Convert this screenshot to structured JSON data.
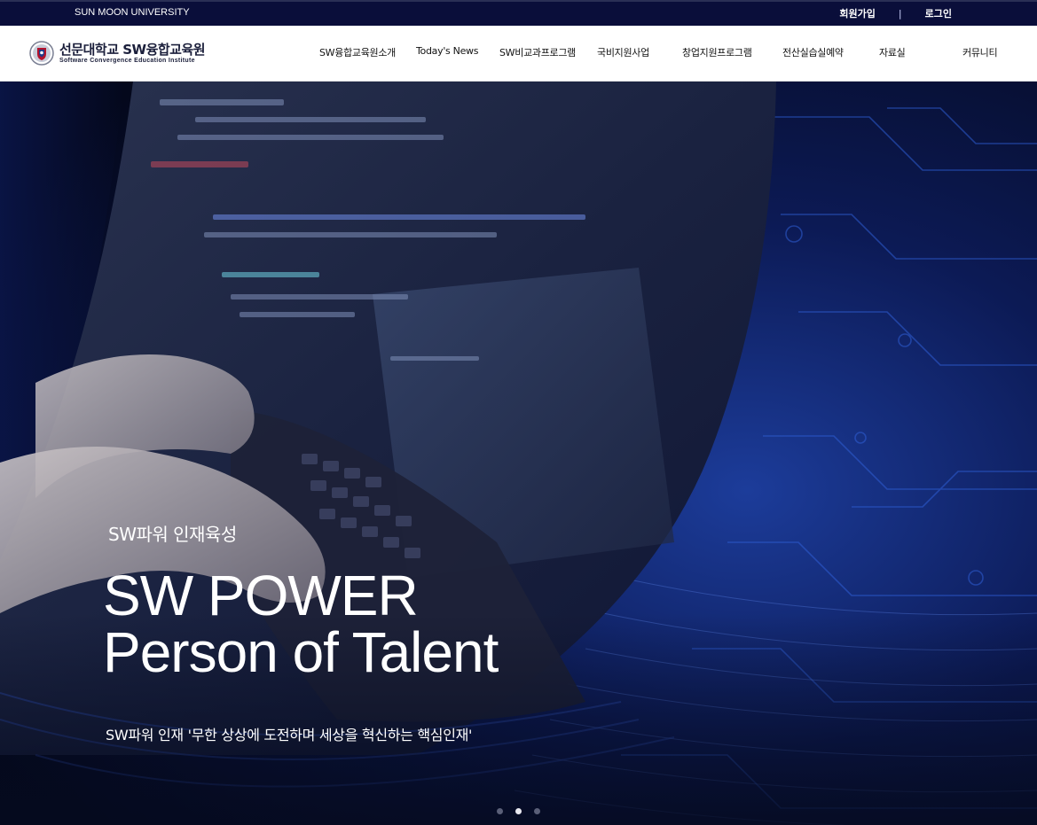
{
  "topbar": {
    "university": "SUN MOON UNIVERSITY",
    "signup": "회원가입",
    "separator": "|",
    "login": "로그인"
  },
  "logo": {
    "title": "선문대학교 SW융합교육원",
    "subtitle": "Software Convergence Education Institute",
    "emblem_icon": "university-emblem-icon"
  },
  "menu": {
    "items": [
      "SW융합교육원소개",
      "Today's News",
      "SW비교과프로그램",
      "국비지원사업",
      "창업지원프로그램",
      "전산실습실예약",
      "자료실",
      "커뮤니티"
    ]
  },
  "hero": {
    "tagline": "SW파워 인재육성",
    "headline_line1": "SW POWER",
    "headline_line2": "Person of Talent",
    "caption": "SW파워 인재 '무한 상상에 도전하며 세상을 혁신하는 핵심인재'",
    "slides_total": 3,
    "active_slide": 2
  },
  "colors": {
    "topbar_bg": "#0a0e3a",
    "hero_accent": "#2f5fd6",
    "text_white": "#ffffff"
  }
}
